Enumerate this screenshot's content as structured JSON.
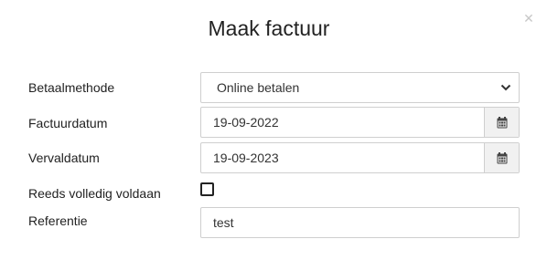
{
  "dialog": {
    "title": "Maak factuur",
    "close_icon": "close-icon"
  },
  "form": {
    "payment_method": {
      "label": "Betaalmethode",
      "value": "Online betalen"
    },
    "invoice_date": {
      "label": "Factuurdatum",
      "value": "19-09-2022",
      "icon": "calendar-icon"
    },
    "due_date": {
      "label": "Vervaldatum",
      "value": "19-09-2023",
      "icon": "calendar-icon"
    },
    "fully_paid": {
      "label": "Reeds volledig voldaan",
      "checked": false
    },
    "reference": {
      "label": "Referentie",
      "value": "test",
      "highlight_color": "#fff34a"
    }
  }
}
